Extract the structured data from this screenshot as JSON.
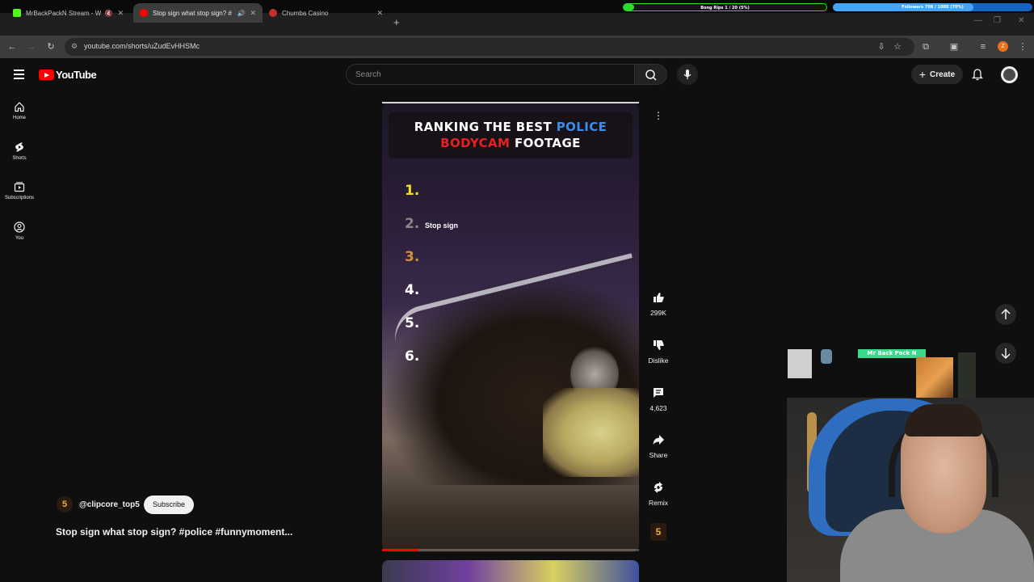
{
  "overlay": {
    "bar1_text": "Bong Rips 1 / 20 (5%)",
    "bar1_progress": 0.05,
    "bar2_text": "Followers 706 / 1000 (70%)",
    "bar2_progress": 0.706
  },
  "tabs": [
    {
      "title": "MrBackPackN Stream - Wa",
      "favicon_color": "#53fc18"
    },
    {
      "title": "Stop sign what stop sign? #",
      "favicon_color": "#ff0000"
    },
    {
      "title": "Chumba Casino",
      "favicon_color": "#c03030"
    }
  ],
  "address_bar": {
    "url": "youtube.com/shorts/uZudEvHHSMc"
  },
  "browser_profile_initial": "Z",
  "youtube": {
    "logo_text": "YouTube",
    "search_placeholder": "Search",
    "create_label": "Create"
  },
  "sidebar": [
    {
      "label": "Home",
      "icon": "home-icon"
    },
    {
      "label": "Shorts",
      "icon": "shorts-icon"
    },
    {
      "label": "Subscriptions",
      "icon": "subscriptions-icon"
    },
    {
      "label": "You",
      "icon": "you-icon"
    }
  ],
  "video": {
    "overlay_title_line1_a": "RANKING THE BEST ",
    "overlay_title_line1_b": "POLICE",
    "overlay_title_line2_a": "BODYCAM",
    "overlay_title_line2_b": " FOOTAGE",
    "ranks": [
      "1.",
      "2.",
      "3.",
      "4.",
      "5.",
      "6."
    ],
    "rank_colors": [
      "#f0e020",
      "#888888",
      "#d09040",
      "#ffffff",
      "#ffffff",
      "#ffffff"
    ],
    "rank2_label": "Stop sign",
    "progress": 0.14
  },
  "actions": {
    "like_count": "299K",
    "dislike_label": "Dislike",
    "comments_count": "4,623",
    "share_label": "Share",
    "remix_label": "Remix"
  },
  "channel": {
    "handle": "@clipcore_top5",
    "avatar_text": "5",
    "subscribe_label": "Subscribe"
  },
  "short_title": "Stop sign what stop sign? #police #funnymoment...",
  "webcam": {
    "sign_text": "Mr Back Pack N"
  }
}
